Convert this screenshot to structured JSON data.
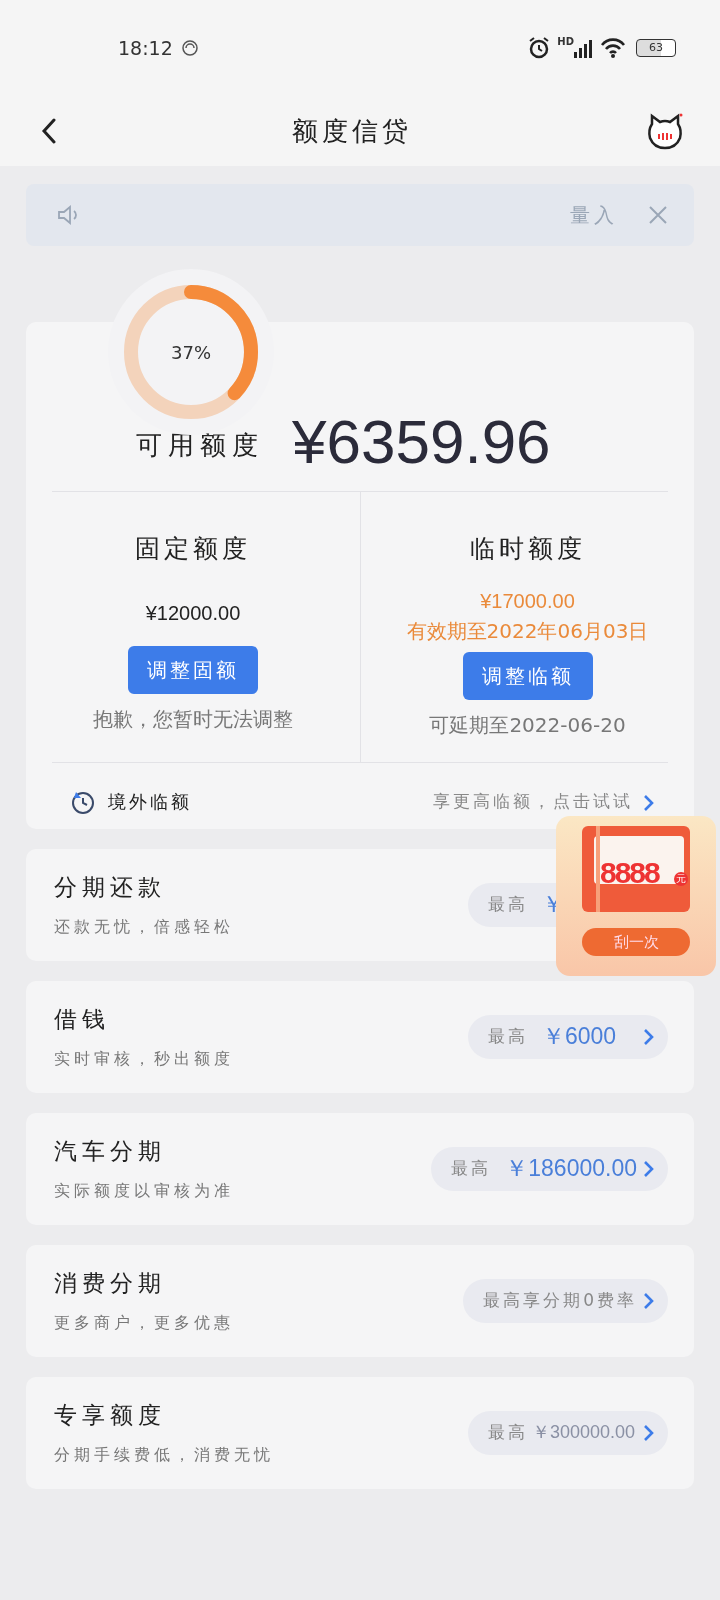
{
  "status_bar": {
    "time": "18:12",
    "network": "HD",
    "battery": "63"
  },
  "header": {
    "title": "额度信贷"
  },
  "notice": {
    "text": "量入"
  },
  "credit": {
    "gauge": {
      "level": 0.37,
      "label": "37%"
    },
    "available_label": "可用额度",
    "available_amount": "¥6359.96"
  },
  "limits": [
    {
      "title": "固定额度",
      "amount": "¥12000.00",
      "highlight": false,
      "button": "调整固额",
      "note": "抱歉，您暂时无法调整"
    },
    {
      "title": "临时额度",
      "amount": "¥17000.00",
      "expiry": "有效期至2022年06月03日",
      "highlight": true,
      "button": "调整临额",
      "note": "可延期至2022-06-20"
    }
  ],
  "overseas": {
    "label": "境外临额",
    "link": "享更高临额，点击试试"
  },
  "products": [
    {
      "title": "分期还款",
      "subtitle": "还款无忧，倍感轻松",
      "pill_label": "最高",
      "pill_value": "￥",
      "chevron": false
    },
    {
      "title": "借钱",
      "subtitle": "实时审核，秒出额度",
      "pill_label": "最高",
      "pill_value": "￥6000",
      "chevron": true
    },
    {
      "title": "汽车分期",
      "subtitle": "实际额度以审核为准",
      "pill_label": "最高",
      "pill_value": "￥186000.00",
      "chevron": true
    },
    {
      "title": "消费分期",
      "subtitle": "更多商户，更多优惠",
      "pill_label": "最高享分期0费率",
      "chevron": true
    },
    {
      "title": "专享额度",
      "subtitle": "分期手续费低，消费无忧",
      "pill_label": "最高",
      "pill_value": "￥300000.00",
      "pill_small": true,
      "chevron": true
    }
  ],
  "promo": {
    "amount": "8888",
    "unit": "元",
    "button": "刮一次"
  }
}
